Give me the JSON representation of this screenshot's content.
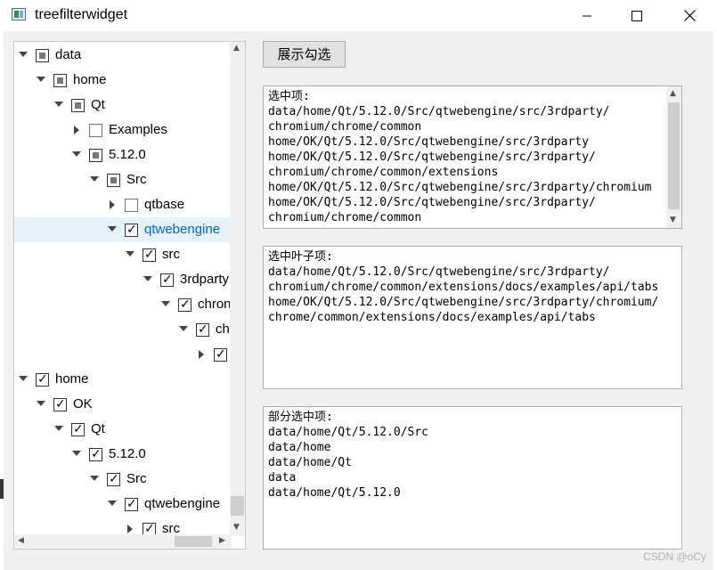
{
  "window": {
    "title": "treefilterwidget"
  },
  "tree": {
    "rows": [
      {
        "label": "data",
        "state": "partial",
        "arrow": "down",
        "indent": 0,
        "selected": false
      },
      {
        "label": "home",
        "state": "partial",
        "arrow": "down",
        "indent": 1,
        "selected": false
      },
      {
        "label": "Qt",
        "state": "partial",
        "arrow": "down",
        "indent": 2,
        "selected": false
      },
      {
        "label": "Examples",
        "state": "empty",
        "arrow": "right",
        "indent": 3,
        "selected": false
      },
      {
        "label": "5.12.0",
        "state": "partial",
        "arrow": "down",
        "indent": 3,
        "selected": false
      },
      {
        "label": "Src",
        "state": "partial",
        "arrow": "down",
        "indent": 4,
        "selected": false
      },
      {
        "label": "qtbase",
        "state": "empty",
        "arrow": "right",
        "indent": 5,
        "selected": false
      },
      {
        "label": "qtwebengine",
        "state": "checked",
        "arrow": "down",
        "indent": 5,
        "selected": true
      },
      {
        "label": "src",
        "state": "checked",
        "arrow": "down",
        "indent": 6,
        "selected": false
      },
      {
        "label": "3rdparty",
        "state": "checked",
        "arrow": "down",
        "indent": 7,
        "selected": false
      },
      {
        "label": "chron",
        "state": "checked",
        "arrow": "down",
        "indent": 8,
        "selected": false
      },
      {
        "label": "ch",
        "state": "checked",
        "arrow": "down",
        "indent": 9,
        "selected": false
      },
      {
        "label": "",
        "state": "checked",
        "arrow": "right",
        "indent": 10,
        "selected": false
      },
      {
        "label": "home",
        "state": "checked",
        "arrow": "down",
        "indent": 0,
        "selected": false
      },
      {
        "label": "OK",
        "state": "checked",
        "arrow": "down",
        "indent": 1,
        "selected": false
      },
      {
        "label": "Qt",
        "state": "checked",
        "arrow": "down",
        "indent": 2,
        "selected": false
      },
      {
        "label": "5.12.0",
        "state": "checked",
        "arrow": "down",
        "indent": 3,
        "selected": false
      },
      {
        "label": "Src",
        "state": "checked",
        "arrow": "down",
        "indent": 4,
        "selected": false
      },
      {
        "label": "qtwebengine",
        "state": "checked",
        "arrow": "down",
        "indent": 5,
        "selected": false
      },
      {
        "label": "src",
        "state": "checked",
        "arrow": "right",
        "indent": 6,
        "selected": false
      }
    ]
  },
  "show_button": {
    "label": "展示勾选"
  },
  "checked_box": {
    "text": "选中项:\ndata/home/Qt/5.12.0/Src/qtwebengine/src/3rdparty/\nchromium/chrome/common\nhome/OK/Qt/5.12.0/Src/qtwebengine/src/3rdparty\nhome/OK/Qt/5.12.0/Src/qtwebengine/src/3rdparty/\nchromium/chrome/common/extensions\nhome/OK/Qt/5.12.0/Src/qtwebengine/src/3rdparty/chromium\nhome/OK/Qt/5.12.0/Src/qtwebengine/src/3rdparty/\nchromium/chrome/common"
  },
  "leaf_box": {
    "text": "选中叶子项:\ndata/home/Qt/5.12.0/Src/qtwebengine/src/3rdparty/\nchromium/chrome/common/extensions/docs/examples/api/tabs\nhome/OK/Qt/5.12.0/Src/qtwebengine/src/3rdparty/chromium/\nchrome/common/extensions/docs/examples/api/tabs"
  },
  "partial_box": {
    "text": "部分选中项:\ndata/home/Qt/5.12.0/Src\ndata/home\ndata/home/Qt\ndata\ndata/home/Qt/5.12.0"
  },
  "watermark": "CSDN @oCy"
}
